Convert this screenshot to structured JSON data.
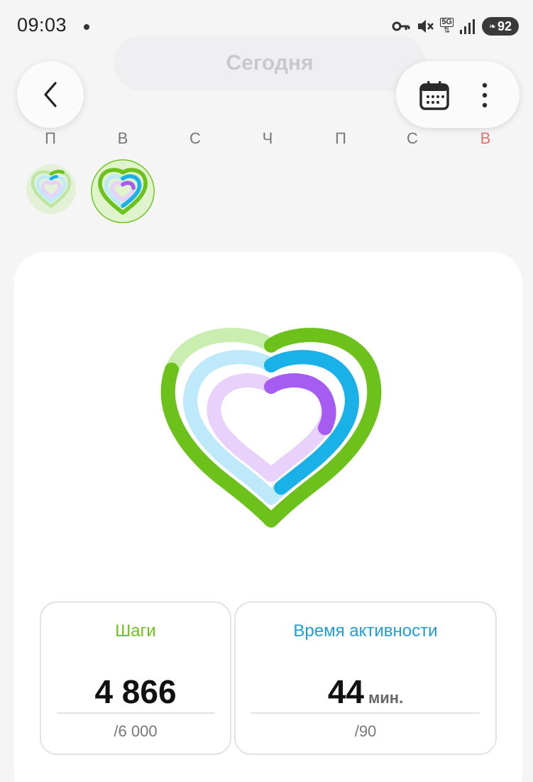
{
  "status_bar": {
    "time": "09:03",
    "network": "5G",
    "battery": "92"
  },
  "header": {
    "title": "Сегодня"
  },
  "week": {
    "days": [
      "П",
      "В",
      "С",
      "Ч",
      "П",
      "С",
      "В"
    ]
  },
  "stats": {
    "steps": {
      "label": "Шаги",
      "value": "4 866",
      "goal": "/6 000"
    },
    "active_time": {
      "label": "Время активности",
      "value": "44",
      "unit": "мин.",
      "goal": "/90"
    }
  },
  "colors": {
    "steps": "#6cc21a",
    "active_time": "#1ab0e8",
    "calories": "#a65cf0",
    "weekend": "#e0706f"
  },
  "icons": [
    "back-arrow-icon",
    "calendar-icon",
    "more-vertical-icon",
    "key-icon",
    "mute-icon",
    "signal-icon",
    "battery-icon"
  ]
}
